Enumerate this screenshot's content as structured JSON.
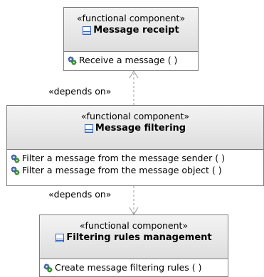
{
  "components": [
    {
      "stereotype": "«functional component»",
      "name": "Message receipt",
      "operations": [
        "Receive a message ( )"
      ]
    },
    {
      "stereotype": "«functional component»",
      "name": "Message filtering",
      "operations": [
        "Filter a message from the message sender ( )",
        "Filter a message from the message object ( )"
      ]
    },
    {
      "stereotype": "«functional component»",
      "name": "Filtering rules management",
      "operations": [
        "Create message filtering rules ( )"
      ]
    }
  ],
  "dependencies": [
    {
      "label": "«depends on»"
    },
    {
      "label": "«depends on»"
    }
  ],
  "colors": {
    "border": "#7d7d7d",
    "header_bg": "#e6e6e6",
    "icon_blue": "#2b62c7",
    "gear_green": "#3a9a2e",
    "gear_blue": "#4d6fb6"
  }
}
